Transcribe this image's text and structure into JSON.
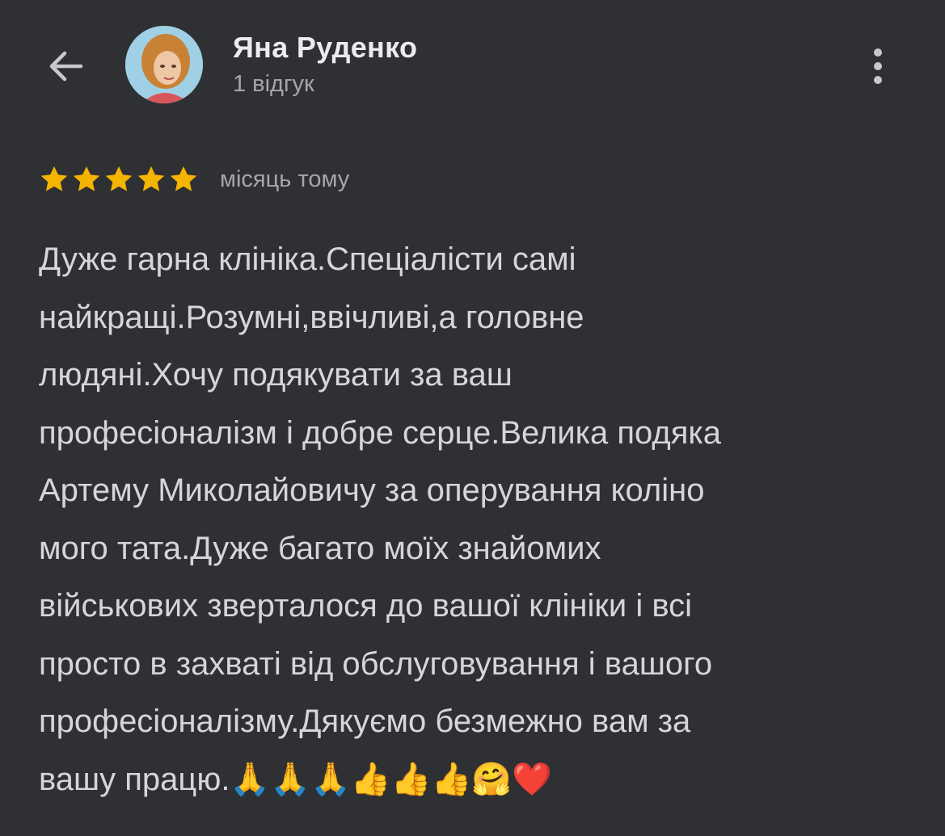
{
  "header": {
    "user_name": "Яна Руденко",
    "review_count": "1 відгук",
    "back_icon": "arrow-left-icon",
    "more_icon": "more-vertical-icon"
  },
  "review": {
    "rating": 5,
    "max_rating": 5,
    "star_color": "#f4b400",
    "time_ago": "місяць тому",
    "text": "Дуже гарна клініка.Спеціалісти самі\nнайкращі.Розумні,ввічливі,а головне\nлюдяні.Хочу подякувати за ваш\nпрофесіоналізм і добре серце.Велика подяка\nАртему Миколайовичу за оперування коліно\nмого тата.Дуже багато моїх знайомих\nвійськових зверталося до вашої клініки і всі\nпросто в захваті від обслуговування і вашого\nпрофесіоналізму.Дякуємо безмежно вам за\nвашу працю.🙏🙏🙏👍👍👍🤗❤️"
  },
  "colors": {
    "background": "#2f3033",
    "primary_text": "#ececee",
    "secondary_text": "#a6a6ab"
  }
}
